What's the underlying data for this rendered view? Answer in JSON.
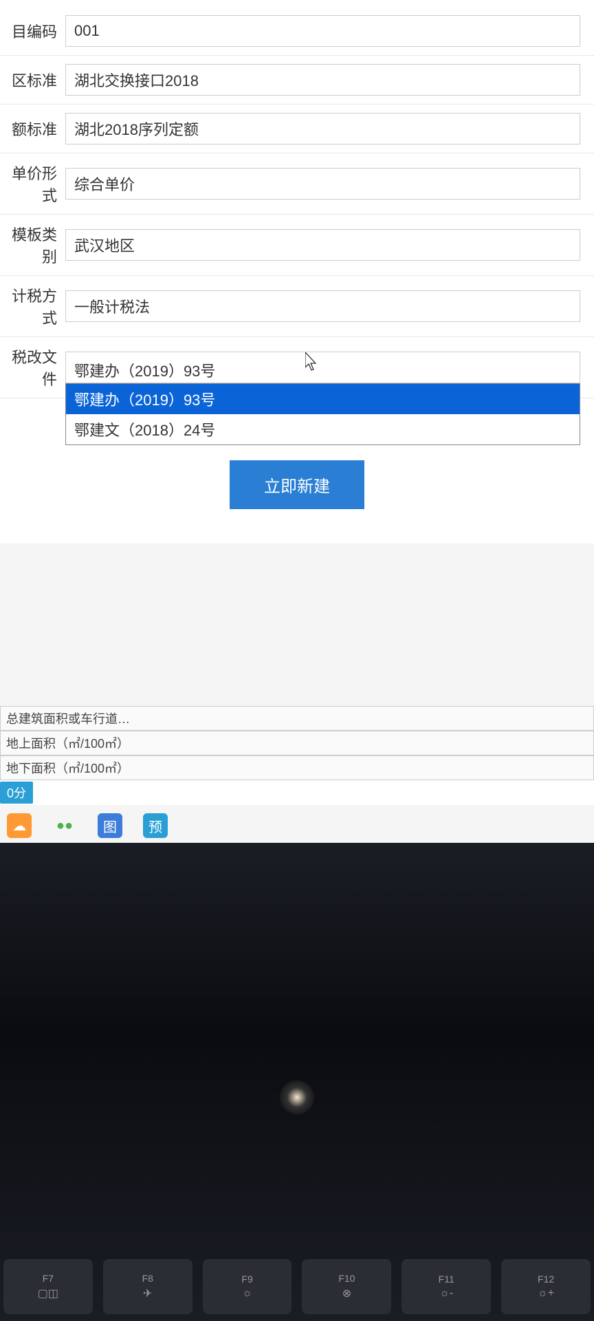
{
  "form": {
    "fields": [
      {
        "label": "目编码",
        "value": "001",
        "type": "text"
      },
      {
        "label": "区标准",
        "value": "湖北交换接口2018",
        "type": "text"
      },
      {
        "label": "额标准",
        "value": "湖北2018序列定额",
        "type": "text"
      },
      {
        "label": "单价形式",
        "value": "综合单价",
        "type": "text"
      },
      {
        "label": "模板类别",
        "value": "武汉地区",
        "type": "text"
      },
      {
        "label": "计税方式",
        "value": "一般计税法",
        "type": "text"
      },
      {
        "label": "税改文件",
        "value": "鄂建办（2019）93号",
        "type": "select"
      }
    ],
    "dropdown_options": [
      {
        "label": "鄂建办（2019）93号",
        "selected": true
      },
      {
        "label": "鄂建文（2018）24号",
        "selected": false
      }
    ],
    "submit_button": "立即新建"
  },
  "bottom_info": {
    "rows": [
      "总建筑面积或车行道…",
      "地上面积（㎡/100㎡）",
      "地下面积（㎡/100㎡）"
    ],
    "score": "0分"
  },
  "fn_keys": [
    "F7",
    "F8",
    "F9",
    "F10",
    "F11",
    "F12"
  ]
}
